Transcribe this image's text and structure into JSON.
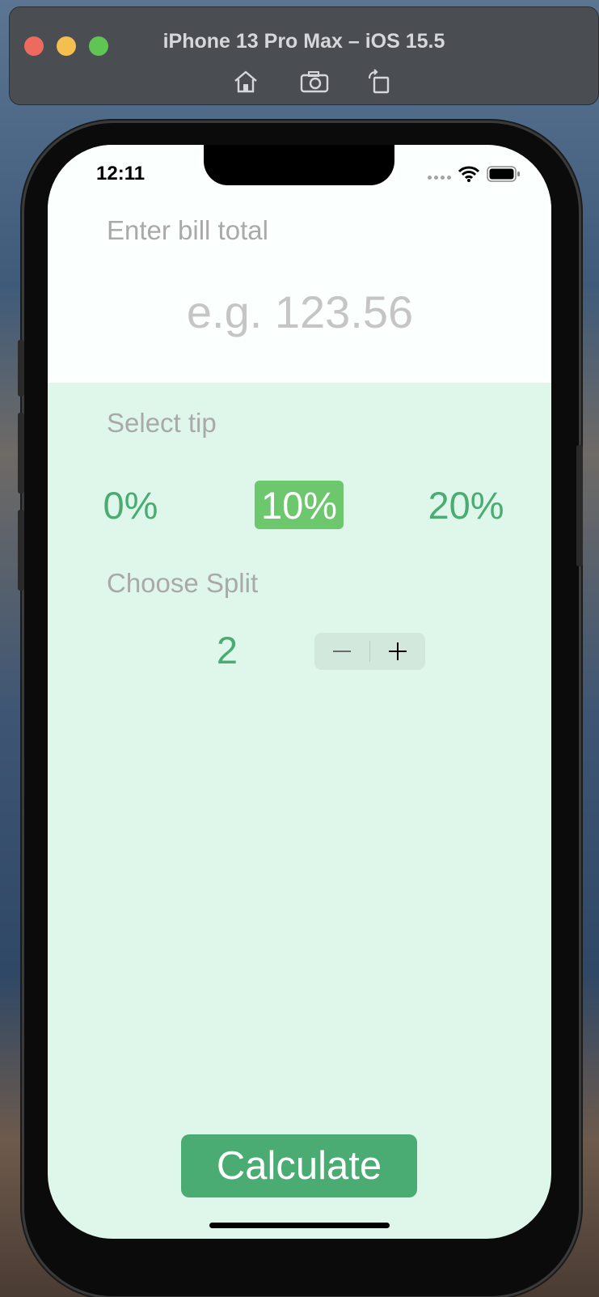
{
  "simulator": {
    "title": "iPhone 13 Pro Max – iOS 15.5",
    "buttons": [
      "home-icon",
      "screenshot-icon",
      "rotate-icon"
    ]
  },
  "status_bar": {
    "time": "12:11",
    "icons": [
      "signal-icon",
      "wifi-icon",
      "battery-icon"
    ]
  },
  "bill": {
    "label": "Enter bill total",
    "placeholder": "e.g. 123.56",
    "value": ""
  },
  "tip": {
    "label": "Select tip",
    "options": [
      "0%",
      "10%",
      "20%"
    ],
    "selected": "10%"
  },
  "split": {
    "label": "Choose Split",
    "value": "2",
    "decrement": "−",
    "increment": "+"
  },
  "calculate": {
    "label": "Calculate"
  },
  "colors": {
    "accent": "#4aac72",
    "selected_tip_bg": "#6dc76c",
    "top_bg": "#fbfffd",
    "body_bg": "#def7ea"
  }
}
